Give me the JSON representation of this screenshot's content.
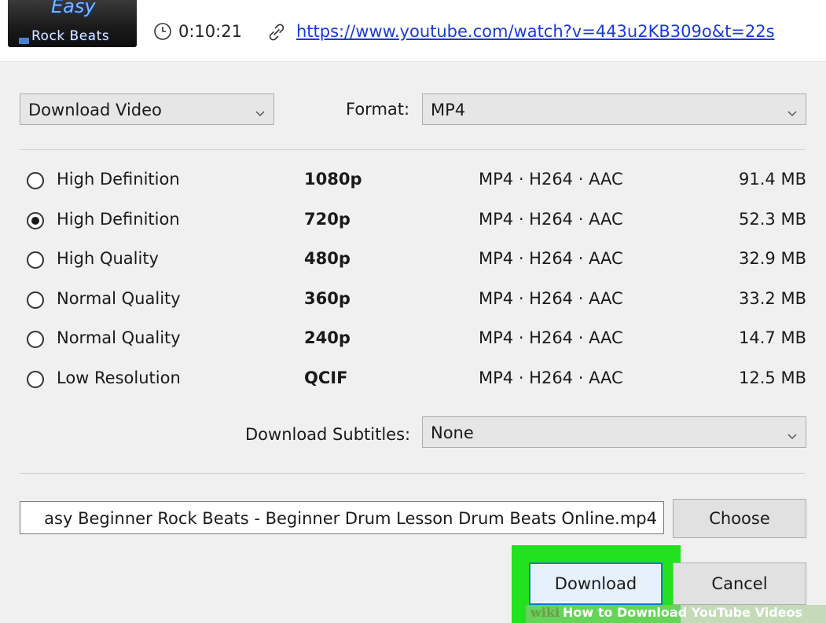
{
  "header": {
    "thumbnail": {
      "line1": "Easy",
      "line2": "Rock Beats"
    },
    "duration": "0:10:21",
    "url": "https://www.youtube.com/watch?v=443u2KB309o&t=22s"
  },
  "controls": {
    "download_type": "Download Video",
    "format_label": "Format:",
    "format_value": "MP4",
    "subtitles_label": "Download Subtitles:",
    "subtitles_value": "None"
  },
  "options": [
    {
      "quality": "High Definition",
      "resolution": "1080p",
      "codec": "MP4 · H264 · AAC",
      "size": "91.4 MB",
      "selected": false
    },
    {
      "quality": "High Definition",
      "resolution": "720p",
      "codec": "MP4 · H264 · AAC",
      "size": "52.3 MB",
      "selected": true
    },
    {
      "quality": "High Quality",
      "resolution": "480p",
      "codec": "MP4 · H264 · AAC",
      "size": "32.9 MB",
      "selected": false
    },
    {
      "quality": "Normal Quality",
      "resolution": "360p",
      "codec": "MP4 · H264 · AAC",
      "size": "33.2 MB",
      "selected": false
    },
    {
      "quality": "Normal Quality",
      "resolution": "240p",
      "codec": "MP4 · H264 · AAC",
      "size": "14.7 MB",
      "selected": false
    },
    {
      "quality": "Low Resolution",
      "resolution": "QCIF",
      "codec": "MP4 · H264 · AAC",
      "size": "12.5 MB",
      "selected": false
    }
  ],
  "file": {
    "name": "asy Beginner Rock Beats - Beginner Drum Lesson   Drum Beats Online.mp4",
    "choose_label": "Choose"
  },
  "actions": {
    "download_label": "Download",
    "cancel_label": "Cancel"
  },
  "watermark": {
    "brand": "wiki",
    "text": "How to Download YouTube Videos"
  },
  "colors": {
    "highlight": "#22e11e",
    "link": "#1a3bd6",
    "focus": "#0078d7"
  }
}
